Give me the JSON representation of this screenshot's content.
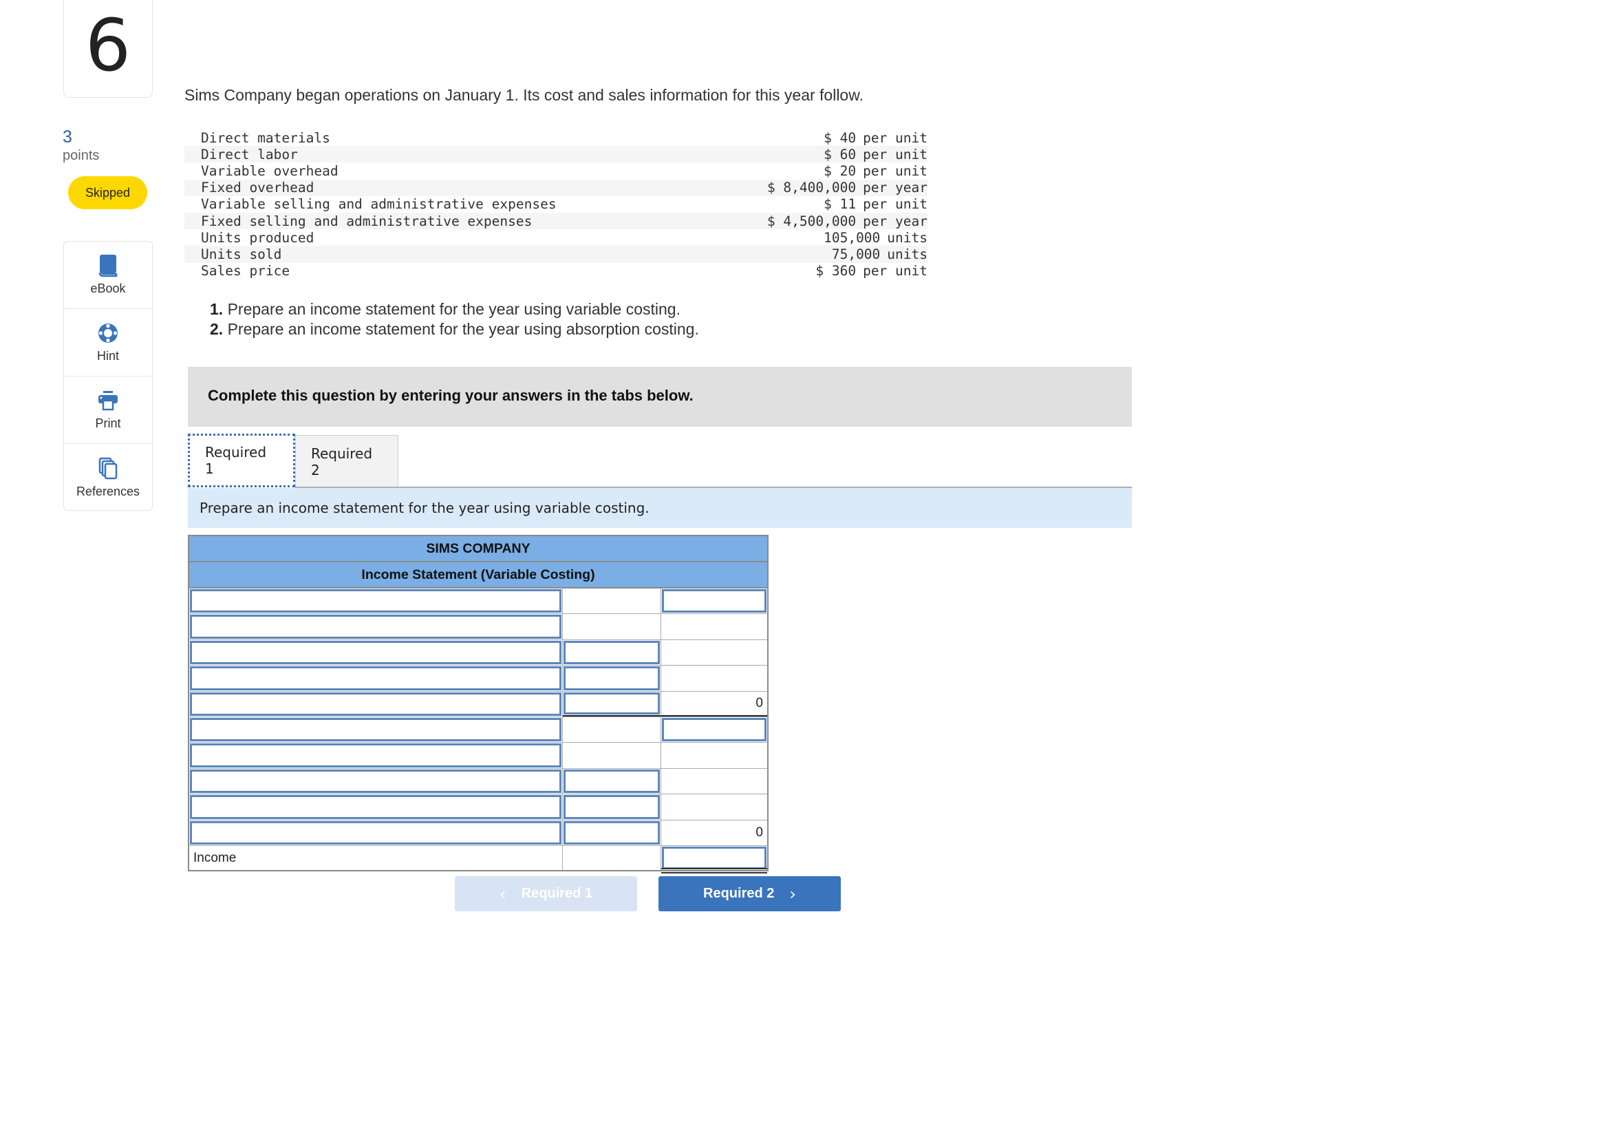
{
  "question": {
    "number": "6",
    "points_value": "3",
    "points_label": "points",
    "status_badge": "Skipped"
  },
  "tools": [
    {
      "label": "eBook",
      "icon": "book-icon"
    },
    {
      "label": "Hint",
      "icon": "lifebuoy-icon"
    },
    {
      "label": "Print",
      "icon": "printer-icon"
    },
    {
      "label": "References",
      "icon": "copy-pages-icon"
    }
  ],
  "intro": "Sims Company began operations on January 1. Its cost and sales information for this year follow.",
  "facts": [
    {
      "label": "Direct materials",
      "value": "$ 40",
      "unit": "per unit"
    },
    {
      "label": "Direct labor",
      "value": "$ 60",
      "unit": "per unit"
    },
    {
      "label": "Variable overhead",
      "value": "$ 20",
      "unit": "per unit"
    },
    {
      "label": "Fixed overhead",
      "value": "$ 8,400,000",
      "unit": "per year"
    },
    {
      "label": "Variable selling and administrative expenses",
      "value": "$ 11",
      "unit": "per unit"
    },
    {
      "label": "Fixed selling and administrative expenses",
      "value": "$ 4,500,000",
      "unit": "per year"
    },
    {
      "label": "Units produced",
      "value": "105,000",
      "unit": "units"
    },
    {
      "label": "Units sold",
      "value": "75,000",
      "unit": "units"
    },
    {
      "label": "Sales price",
      "value": "$ 360",
      "unit": "per unit"
    }
  ],
  "requirements": [
    {
      "num": "1.",
      "text": "Prepare an income statement for the year using variable costing."
    },
    {
      "num": "2.",
      "text": "Prepare an income statement for the year using absorption costing."
    }
  ],
  "instruction": "Complete this question by entering your answers in the tabs below.",
  "tabs": [
    {
      "label": "Required 1",
      "active": true
    },
    {
      "label": "Required 2",
      "active": false
    }
  ],
  "prompt": "Prepare an income statement for the year using variable costing.",
  "statement": {
    "company": "SIMS COMPANY",
    "title": "Income Statement (Variable Costing)",
    "rows": [
      {
        "label": "",
        "col2": "",
        "col3": ""
      },
      {
        "label": "",
        "col2": "",
        "col3": ""
      },
      {
        "label": "",
        "col2": "",
        "col3": ""
      },
      {
        "label": "",
        "col2": "",
        "col3": ""
      },
      {
        "label": "",
        "col2": "",
        "col3": "0"
      },
      {
        "label": "",
        "col2": "",
        "col3": ""
      },
      {
        "label": "",
        "col2": "",
        "col3": ""
      },
      {
        "label": "",
        "col2": "",
        "col3": ""
      },
      {
        "label": "",
        "col2": "",
        "col3": ""
      },
      {
        "label": "",
        "col2": "",
        "col3": "0"
      },
      {
        "label": "Income",
        "col2": "",
        "col3": ""
      }
    ]
  },
  "nav": {
    "prev_label": "Required 1",
    "next_label": "Required 2",
    "prev_chevron": "‹",
    "next_chevron": "›"
  },
  "colors": {
    "accent_blue": "#3a74bc",
    "header_blue": "#7aaee4",
    "skipped_yellow": "#fdd800",
    "prompt_bg": "#dbeaf8"
  }
}
